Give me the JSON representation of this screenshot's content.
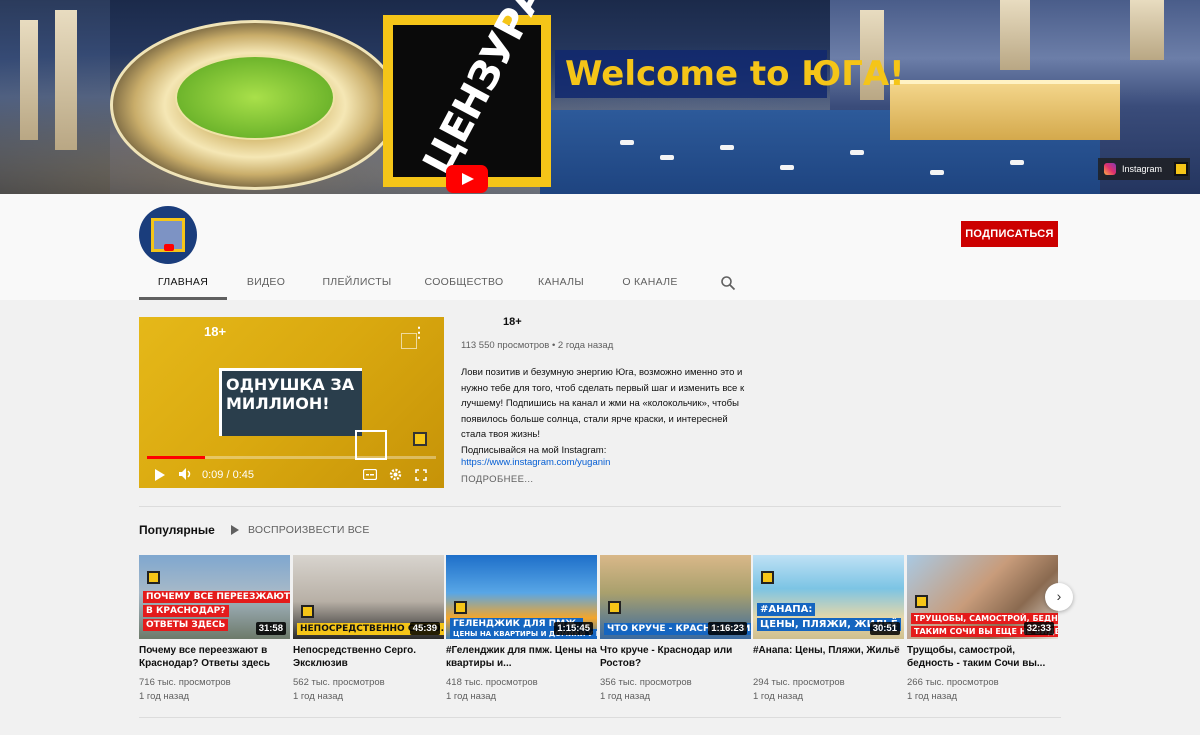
{
  "banner": {
    "censor_text": "ЦЕНЗУРА",
    "welcome_text": "Welcome to ЮГА!",
    "instagram_label": "Instagram"
  },
  "header": {
    "subscribe_label": "ПОДПИСАТЬСЯ",
    "tabs": [
      {
        "label": "ГЛАВНАЯ",
        "active": true
      },
      {
        "label": "ВИДЕО"
      },
      {
        "label": "ПЛЕЙЛИСТЫ"
      },
      {
        "label": "СООБЩЕСТВО"
      },
      {
        "label": "КАНАЛЫ"
      },
      {
        "label": "О КАНАЛЕ"
      }
    ]
  },
  "featured": {
    "age_badge": "18+",
    "title_card": "ОДНУШКА ЗА МИЛЛИОН!",
    "time_current": "0:09",
    "time_separator": "/",
    "time_total": "0:45",
    "progress_fraction": 0.2,
    "title": "18+",
    "meta": "113 550 просмотров • 2 года назад",
    "description_lines": [
      "Лови позитив и безумную энергию Юга, возможно именно это и",
      "нужно тебе для того, чтоб сделать первый шаг и изменить все к",
      "лучшему! Подпишись на канал и жми на «колокольчик», чтобы",
      "появилось больше солнца, стали ярче краски, и интересней",
      "стала твоя жизнь!",
      "Подписывайся на мой Instagram:"
    ],
    "link": "https://www.instagram.com/yuganin",
    "more_label": "ПОДРОБНЕЕ..."
  },
  "shelf": {
    "title": "Популярные",
    "play_all_label": "ВОСПРОИЗВЕСТИ ВСЕ",
    "videos": [
      {
        "overlay1": "ПОЧЕМУ ВСЕ ПЕРЕЕЗЖАЮТ",
        "overlay2": "В КРАСНОДАР?",
        "overlay3": "ОТВЕТЫ ЗДЕСЬ",
        "duration": "31:58",
        "title": "Почему все переезжают в Краснодар? Ответы здесь",
        "views": "716 тыс. просмотров",
        "age": "1 год назад"
      },
      {
        "overlay1": "НЕПОСРЕДСТВЕННО СЕРГО. ЭКСКЛ",
        "duration": "45:39",
        "title": "Непосредственно Серго. Эксклюзив",
        "views": "562 тыс. просмотров",
        "age": "1 год назад"
      },
      {
        "overlay1": "ГЕЛЕНДЖИК ДЛЯ ПМЖ.",
        "overlay2": "ЦЕНЫ НА КВАРТИРЫ И ДОМИКИ У МОРЯ",
        "duration": "1:15:45",
        "title": "#Геленджик для пмж. Цены на квартиры и...",
        "views": "418 тыс. просмотров",
        "age": "1 год назад"
      },
      {
        "overlay1": "ЧТО КРУЧЕ - КРАСНОДАР ИЛИ",
        "duration": "1:16:23",
        "title": "Что круче - Краснодар или Ростов?",
        "views": "356 тыс. просмотров",
        "age": "1 год назад"
      },
      {
        "overlay1": "#АНАПА:",
        "overlay2": "ЦЕНЫ, ПЛЯЖИ, ЖИЛЬЁ",
        "duration": "30:51",
        "title": "#Анапа: Цены, Пляжи, Жильё",
        "views": "294 тыс. просмотров",
        "age": "1 год назад"
      },
      {
        "overlay1": "ТРУЩОБЫ, САМОСТРОЙ, БЕДНОСТЬ",
        "overlay2": "ТАКИМ СОЧИ ВЫ ЕЩЕ НЕ ВИДЕЛИ",
        "duration": "32:33",
        "title": "Трущобы, самострой, бедность - таким Сочи вы...",
        "views": "266 тыс. просмотров",
        "age": "1 год назад"
      }
    ]
  },
  "colors": {
    "subscribe": "#cc0000",
    "progress": "#ff0000",
    "brand_yellow": "#f5c518"
  }
}
